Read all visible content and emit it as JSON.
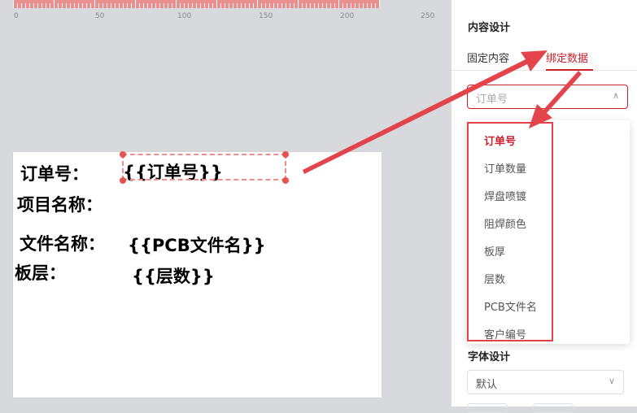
{
  "ruler": {
    "labels": [
      "0",
      "50",
      "100",
      "150",
      "200",
      "250"
    ]
  },
  "canvas": {
    "labels": {
      "order_no": "订单号：",
      "project_name": "项目名称：",
      "file_name": "文件名称：",
      "layer": "板层："
    },
    "fields": {
      "order_no": "{{订单号}}",
      "pcb_file": "{{PCB文件名}}",
      "layer_count": "{{层数}}"
    }
  },
  "panel": {
    "title": "内容设计",
    "tabs": {
      "fixed": "固定内容",
      "bound": "绑定数据"
    },
    "select": {
      "placeholder": "订单号",
      "arrow": "∧"
    },
    "options": [
      "订单号",
      "订单数量",
      "焊盘喷镀",
      "阻焊颜色",
      "板厚",
      "层数",
      "PCB文件名",
      "客户编号"
    ],
    "font_title": "字体设计",
    "font_select": {
      "value": "默认",
      "arrow": "∨"
    }
  },
  "colors": {
    "accent": "#c8202a",
    "annotation": "#e3444b",
    "selection": "#f08d8d"
  }
}
